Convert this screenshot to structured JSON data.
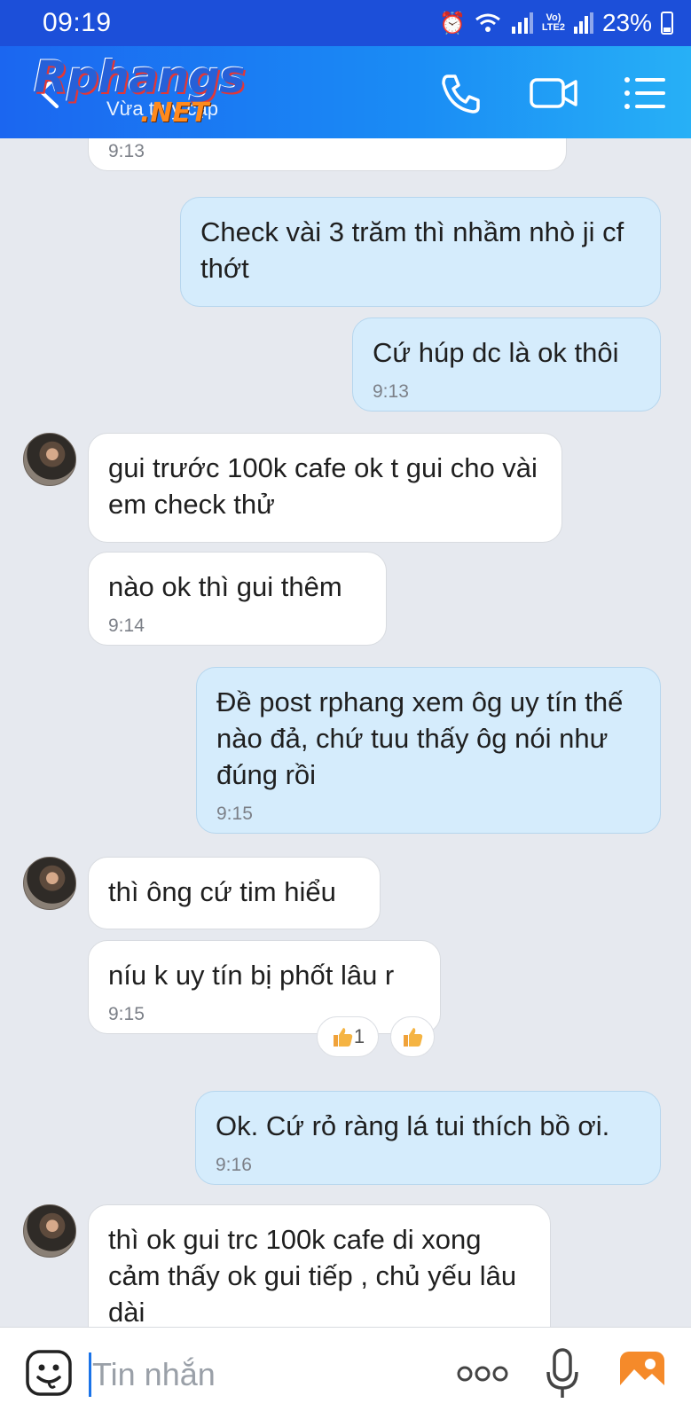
{
  "status_bar": {
    "time": "09:19",
    "network": "LTE2",
    "battery": "23%"
  },
  "header": {
    "logo_main": "Rphangs",
    "logo_sub": ".NET",
    "contact_status": "Vừa truy cập",
    "icons": [
      "back-arrow-icon",
      "phone-icon",
      "video-call-icon",
      "menu-icon"
    ]
  },
  "messages": [
    {
      "side": "in",
      "text": "",
      "time": "9:13"
    },
    {
      "side": "out",
      "text": "Check vài 3 trăm thì nhầm nhò ji cf thớt",
      "time": ""
    },
    {
      "side": "out",
      "text": "Cứ húp dc là ok thôi",
      "time": "9:13"
    },
    {
      "side": "in",
      "text": "gui trước 100k cafe ok t gui cho vài em check thử",
      "time": ""
    },
    {
      "side": "in",
      "text": "nào ok thì gui thêm",
      "time": "9:14"
    },
    {
      "side": "out",
      "text": "Đề post rphang xem ôg uy tín thế nào đả, chứ tuu thấy ôg nói như đúng rồi",
      "time": "9:15"
    },
    {
      "side": "in",
      "text": "thì ông cứ tim hiểu",
      "time": ""
    },
    {
      "side": "in",
      "text": "níu k uy tín bị phốt lâu r",
      "time": "9:15",
      "reaction_count": "1"
    },
    {
      "side": "out",
      "text": "Ok. Cứ rỏ ràng lá tui thích bồ ơi.",
      "time": "9:16"
    },
    {
      "side": "in",
      "text": "thì ok gui trc 100k cafe di xong cảm thấy ok gui tiếp , chủ yếu lâu dài",
      "time": ""
    }
  ],
  "input_bar": {
    "placeholder": "Tin nhắn"
  },
  "colors": {
    "status_bar": "#1c4fd9",
    "header": "#1a8cf5",
    "incoming": "#ffffff",
    "outgoing": "#d5ecfc",
    "background": "#e6e9ef"
  }
}
